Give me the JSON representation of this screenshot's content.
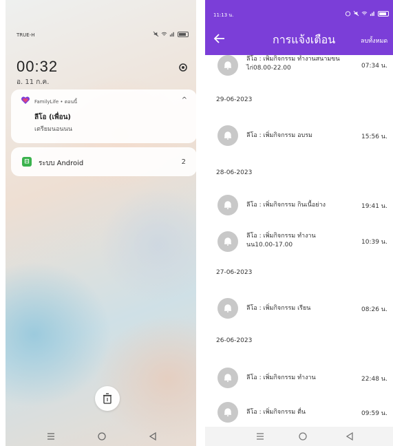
{
  "left_phone": {
    "status_bar": {
      "carrier": "TRUE-H"
    },
    "lock_clock": {
      "time": "00:32",
      "date": "อ. 11 ก.ค."
    },
    "notification": {
      "app": "FamilyLife • ตอนนี้",
      "title": "ลีโอ (เพื่อน)",
      "body": "เตรียมนอนนน"
    },
    "system_notification": {
      "label": "ระบบ Android",
      "count": "2"
    },
    "icons": [
      "settings-icon",
      "heart-icon",
      "chevron-up-icon",
      "trash-icon",
      "menu-icon",
      "home-icon",
      "back-icon"
    ]
  },
  "right_phone": {
    "status_bar": {
      "time": "11:13 น."
    },
    "app_bar": {
      "title": "การแจ้งเตือน",
      "clear_all": "ลบทั้งหมด"
    },
    "colors": {
      "accent": "#7b3ed8",
      "bell_bg": "#c8c8c8"
    },
    "top_partial": {
      "text_line1": "ลีโอ : เพิ่มกิจกรรม ทำงานสนามขน",
      "text_line2": "ไก่08.00-22.00",
      "time": "07:34 น."
    },
    "groups": [
      {
        "date": "29-06-2023",
        "items": [
          {
            "text": "ลีโอ : เพิ่มกิจกรรม อบรม",
            "time": "15:56 น."
          }
        ]
      },
      {
        "date": "28-06-2023",
        "items": [
          {
            "text": "ลีโอ : เพิ่มกิจกรรม กินเนื้อย่าง",
            "time": "19:41 น."
          },
          {
            "text_line1": "ลีโอ : เพิ่มกิจกรรม ทำงาน",
            "text_line2": "นน10.00-17.00",
            "time": "10:39 น."
          }
        ]
      },
      {
        "date": "27-06-2023",
        "items": [
          {
            "text": "ลีโอ : เพิ่มกิจกรรม เรียน",
            "time": "08:26 น."
          }
        ]
      },
      {
        "date": "26-06-2023",
        "items": [
          {
            "text": "ลีโอ : เพิ่มกิจกรรม ทำงาน",
            "time": "22:48 น."
          },
          {
            "text": "ลีโอ : เพิ่มกิจกรรม ตื่น",
            "time": "09:59 น."
          }
        ]
      }
    ]
  }
}
